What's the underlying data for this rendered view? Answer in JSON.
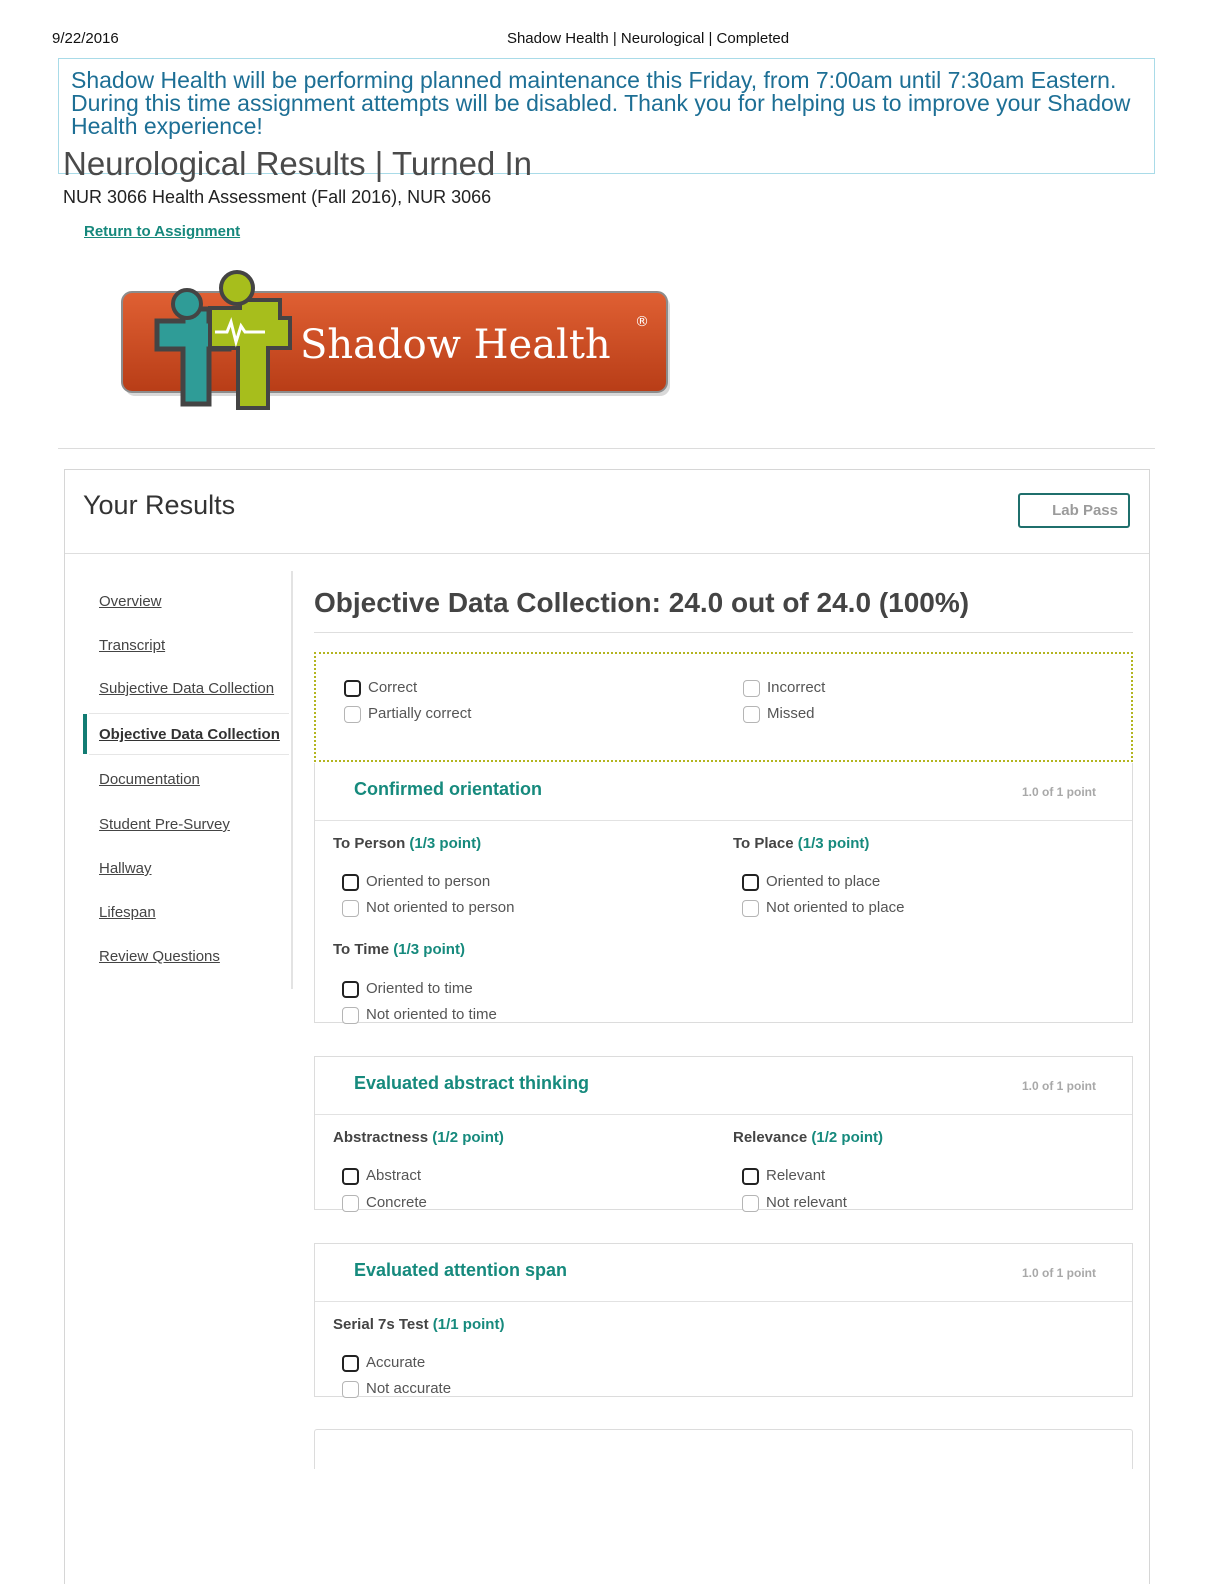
{
  "print_header": {
    "date": "9/22/2016",
    "title": "Shadow Health | Neurological | Completed"
  },
  "banner": {
    "message": "Shadow Health will be performing planned maintenance this Friday, from 7:00am until 7:30am Eastern. During this time assignment attempts will be disabled. Thank you for helping us to improve your Shadow Health experience!"
  },
  "page": {
    "heading": "Neurological Results | Turned In",
    "course": "NUR 3066 Health Assessment (Fall 2016), NUR 3066",
    "return_link": "Return to Assignment"
  },
  "logo": {
    "text": "Shadow Health"
  },
  "colors": {
    "accent": "#168a7d",
    "banner_text": "#1d6f95",
    "logo_orange": "#c9491f",
    "logo_green": "#a7be1c",
    "logo_teal": "#2f9c97"
  },
  "results": {
    "title": "Your Results",
    "lab_pass": "Lab Pass"
  },
  "sidebar": {
    "items": [
      {
        "label": "Overview"
      },
      {
        "label": "Transcript"
      },
      {
        "label": "Subjective Data Collection"
      },
      {
        "label": "Objective Data Collection",
        "active": true
      },
      {
        "label": "Documentation"
      },
      {
        "label": "Student Pre-Survey"
      },
      {
        "label": "Hallway"
      },
      {
        "label": "Lifespan"
      },
      {
        "label": "Review Questions"
      }
    ]
  },
  "main": {
    "section_title": "Objective Data Collection: 24.0 out of 24.0 (100%)",
    "legend": {
      "correct": "Correct",
      "partially_correct": "Partially correct",
      "incorrect": "Incorrect",
      "missed": "Missed"
    },
    "blocks": [
      {
        "title": "Confirmed orientation",
        "score": "1.0 of 1 point",
        "groups": [
          {
            "name": "To Person",
            "points": "(1/3 point)",
            "options": [
              "Oriented to person",
              "Not oriented to person"
            ]
          },
          {
            "name": "To Place",
            "points": "(1/3 point)",
            "options": [
              "Oriented to place",
              "Not oriented to place"
            ]
          },
          {
            "name": "To Time",
            "points": "(1/3 point)",
            "options": [
              "Oriented to time",
              "Not oriented to time"
            ]
          }
        ]
      },
      {
        "title": "Evaluated abstract thinking",
        "score": "1.0 of 1 point",
        "groups": [
          {
            "name": "Abstractness",
            "points": "(1/2 point)",
            "options": [
              "Abstract",
              "Concrete"
            ]
          },
          {
            "name": "Relevance",
            "points": "(1/2 point)",
            "options": [
              "Relevant",
              "Not relevant"
            ]
          }
        ]
      },
      {
        "title": "Evaluated attention span",
        "score": "1.0 of 1 point",
        "groups": [
          {
            "name": "Serial 7s Test",
            "points": "(1/1 point)",
            "options": [
              "Accurate",
              "Not accurate"
            ]
          }
        ]
      }
    ]
  }
}
